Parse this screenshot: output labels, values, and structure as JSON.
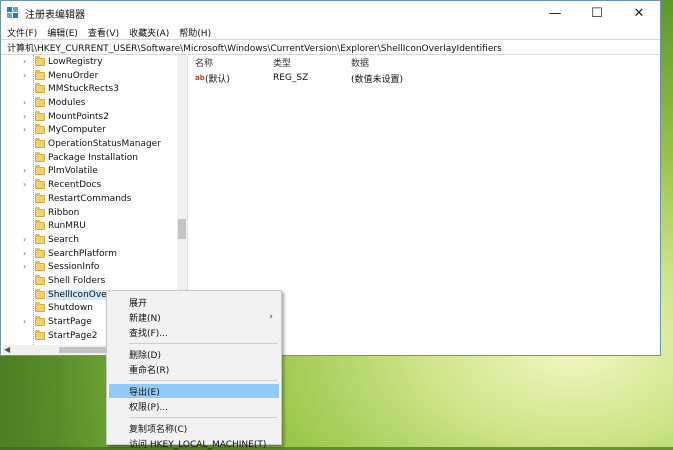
{
  "window": {
    "title": "注册表编辑器",
    "controls": {
      "minimize": "—",
      "maximize": "☐",
      "close": "✕"
    }
  },
  "menubar": [
    "文件(F)",
    "编辑(E)",
    "查看(V)",
    "收藏夹(A)",
    "帮助(H)"
  ],
  "address": "计算机\\HKEY_CURRENT_USER\\Software\\Microsoft\\Windows\\CurrentVersion\\Explorer\\ShellIconOverlayIdentifiers",
  "tree": {
    "items": [
      {
        "label": "LowRegistry",
        "expandable": true
      },
      {
        "label": "MenuOrder",
        "expandable": true
      },
      {
        "label": "MMStuckRects3",
        "expandable": false
      },
      {
        "label": "Modules",
        "expandable": true
      },
      {
        "label": "MountPoints2",
        "expandable": true
      },
      {
        "label": "MyComputer",
        "expandable": true
      },
      {
        "label": "OperationStatusManager",
        "expandable": false
      },
      {
        "label": "Package Installation",
        "expandable": false
      },
      {
        "label": "PlmVolatile",
        "expandable": true
      },
      {
        "label": "RecentDocs",
        "expandable": true
      },
      {
        "label": "RestartCommands",
        "expandable": false
      },
      {
        "label": "Ribbon",
        "expandable": false
      },
      {
        "label": "RunMRU",
        "expandable": false
      },
      {
        "label": "Search",
        "expandable": true
      },
      {
        "label": "SearchPlatform",
        "expandable": true
      },
      {
        "label": "SessionInfo",
        "expandable": true
      },
      {
        "label": "Shell Folders",
        "expandable": false
      },
      {
        "label": "ShellIconOverlayIdentifiers",
        "expandable": false,
        "selected": true
      },
      {
        "label": "Shutdown",
        "expandable": false
      },
      {
        "label": "StartPage",
        "expandable": true
      },
      {
        "label": "StartPage2",
        "expandable": false
      }
    ]
  },
  "list": {
    "columns": [
      "名称",
      "类型",
      "数据"
    ],
    "rows": [
      {
        "name": "(默认)",
        "type": "REG_SZ",
        "data": "(数值未设置)",
        "icon": "ab"
      }
    ]
  },
  "context_menu": {
    "items": [
      {
        "label": "展开",
        "submenu": false
      },
      {
        "label": "新建(N)",
        "submenu": true
      },
      {
        "label": "查找(F)...",
        "submenu": false
      },
      {
        "separator": true
      },
      {
        "label": "删除(D)",
        "submenu": false
      },
      {
        "label": "重命名(R)",
        "submenu": false
      },
      {
        "separator": true
      },
      {
        "label": "导出(E)",
        "submenu": false,
        "highlighted": true
      },
      {
        "label": "权限(P)...",
        "submenu": false
      },
      {
        "separator": true
      },
      {
        "label": "复制项名称(C)",
        "submenu": false
      },
      {
        "label": "访问 HKEY_LOCAL_MACHINE(T)",
        "submenu": false
      }
    ]
  },
  "colors": {
    "selection": "#cde8ff",
    "menu_highlight": "#91c9f7",
    "folder": "#f4d26e",
    "title_icon": "#1f7bd6"
  }
}
